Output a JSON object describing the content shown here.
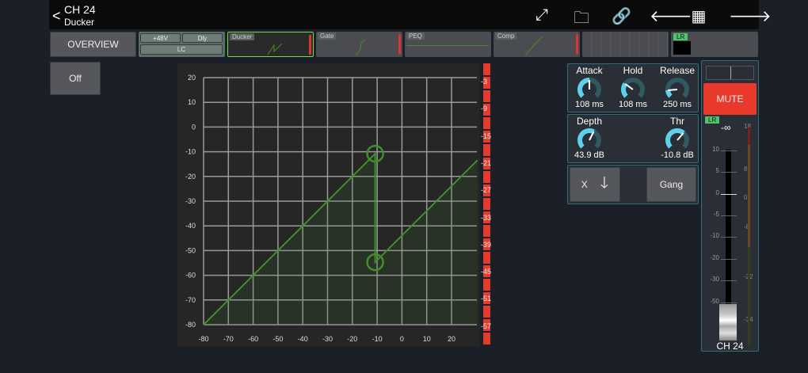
{
  "header": {
    "channel": "CH 24",
    "page": "Ducker",
    "icons": [
      "fullscreen-icon",
      "folder-icon",
      "link-icon",
      "arrow-left-icon",
      "grid-icon",
      "arrow-right-icon"
    ]
  },
  "strip": {
    "overview": "OVERVIEW",
    "phantom": "+48V",
    "delay": "Dly",
    "lowcut": "LC",
    "ducker": "Ducker",
    "gate": "Gate",
    "peq": "PEQ",
    "comp": "Comp",
    "lr": "LR"
  },
  "off_button": "Off",
  "plot": {
    "x_ticks": [
      -80,
      -70,
      -60,
      -50,
      -40,
      -30,
      -20,
      -10,
      0,
      10,
      20
    ],
    "y_ticks": [
      20,
      10,
      0,
      -10,
      -20,
      -30,
      -40,
      -50,
      -60,
      -70,
      -80
    ],
    "threshold": -10.8,
    "depth": 43.9
  },
  "meter_labels": [
    "-3",
    "-9",
    "-15",
    "-21",
    "-27",
    "-33",
    "-39",
    "-45",
    "-51",
    "-57"
  ],
  "knobs": {
    "attack": {
      "label": "Attack",
      "value": "108 ms",
      "level": 0.5
    },
    "hold": {
      "label": "Hold",
      "value": "108 ms",
      "level": 0.3
    },
    "release": {
      "label": "Release",
      "value": "250 ms",
      "level": 0.15
    },
    "depth": {
      "label": "Depth",
      "value": "43.9 dB",
      "level": 0.6
    },
    "thr": {
      "label": "Thr",
      "value": "-10.8 dB",
      "level": 0.65
    }
  },
  "buttons": {
    "key": "X",
    "gang": "Gang",
    "mute": "MUTE"
  },
  "fader": {
    "bus": "LR",
    "level": "-∞",
    "scale": [
      "10",
      "5",
      "0",
      "-5",
      "-10",
      "-20",
      "-30",
      "-50"
    ],
    "meter_scale": [
      "18",
      "8",
      "0",
      "-8",
      "-22",
      "-34"
    ],
    "name": "CH 24"
  },
  "colors": {
    "accent": "#2f6f7c",
    "mute": "#e8392b",
    "curve": "#3f8f2a",
    "knob": "#5fd0ea"
  }
}
